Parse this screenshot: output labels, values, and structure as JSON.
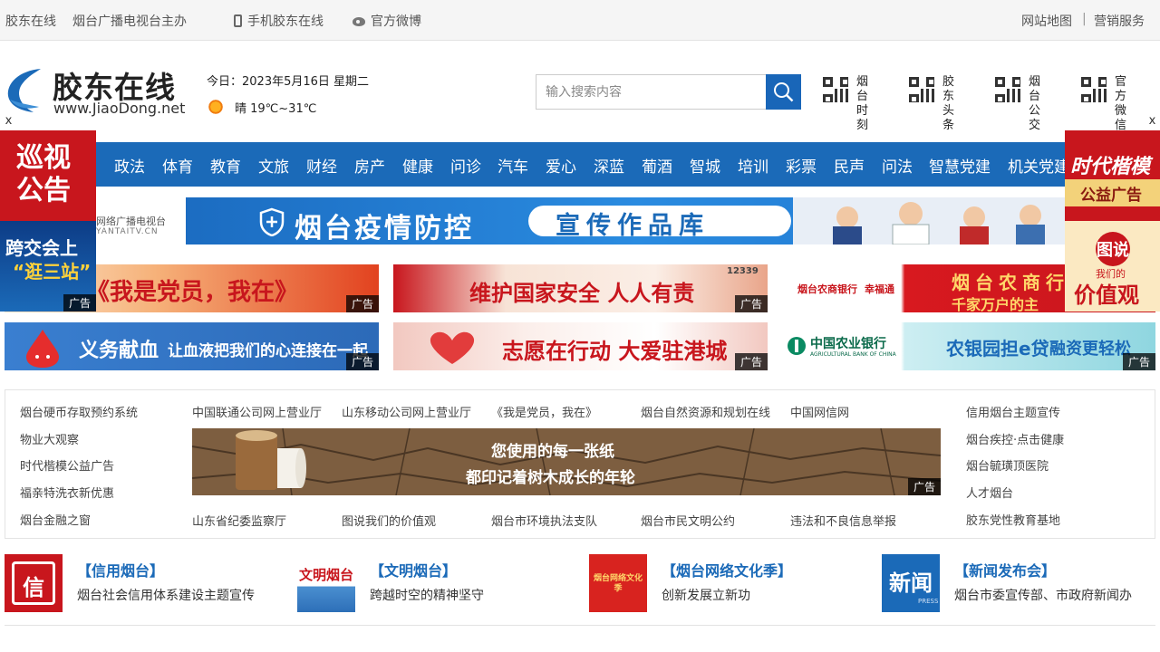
{
  "topbar": {
    "site": "胶东在线",
    "sponsor": "烟台广播电视台主办",
    "mobile": "手机胶东在线",
    "weibo": "官方微博",
    "sitemap": "网站地图",
    "sep": "|",
    "marketing": "营销服务"
  },
  "header": {
    "logo_text": "胶东在线",
    "logo_url": "www.JiaoDong.net",
    "date": "今日：2023年5月16日 星期二",
    "weather": "晴 19℃~31℃",
    "search_placeholder": "输入搜索内容",
    "qr_items": [
      {
        "label": "烟台时刻"
      },
      {
        "label": "胶东头条"
      },
      {
        "label": "烟台公交"
      },
      {
        "label": "官方微信"
      }
    ]
  },
  "nav": {
    "items": [
      "政法",
      "体育",
      "教育",
      "文旅",
      "财经",
      "房产",
      "健康",
      "问诊",
      "汽车",
      "爱心",
      "深蓝",
      "葡酒",
      "智城",
      "培训",
      "彩票",
      "民声",
      "问法",
      "智慧党建",
      "机关党建"
    ]
  },
  "side_ads": {
    "close": "x",
    "left_top": [
      "巡视",
      "公告"
    ],
    "left_bottom": [
      "跨交会上",
      "“逛三站”"
    ],
    "right_top": [
      "时代楷模",
      "公益广告"
    ],
    "right_bottom": [
      "图说",
      "我们的",
      "价值观"
    ],
    "ad_label": "广告"
  },
  "banner": {
    "logo_text": "网络广播电视台",
    "logo_url": "YANTAITV.CN",
    "title": "烟台疫情防控",
    "pill": "宣传作品库"
  },
  "ads": [
    {
      "text": "《我是党员，我在》",
      "label": "广告"
    },
    {
      "text": "维护国家安全 人人有责",
      "badge": "12339",
      "label": "广告"
    },
    {
      "bank": "烟台农商银行",
      "brand": "幸福通",
      "text": "烟台农商行",
      "sub": "千家万户的主",
      "label": "广告"
    },
    {
      "text": "义务献血",
      "sub": "让血液把我们的心连接在一起",
      "label": "广告"
    },
    {
      "text": "志愿在行动 大爱驻港城",
      "label": "广告"
    },
    {
      "bank": "中国农业银行",
      "bank_en": "AGRICULTURAL BANK OF CHINA",
      "text": "农银园担e贷",
      "sub": "融资更轻松",
      "label": "广告"
    }
  ],
  "links": {
    "left": [
      "烟台硬币存取预约系统",
      "物业大观察",
      "时代楷模公益广告",
      "福亲特洗衣新优惠",
      "烟台金融之窗"
    ],
    "top": [
      "中国联通公司网上营业厅",
      "山东移动公司网上营业厅",
      "《我是党员，我在》",
      "烟台自然资源和规划在线",
      "中国网信网"
    ],
    "right": [
      "信用烟台主题宣传",
      "烟台疾控·点击健康",
      "烟台毓璜顶医院",
      "人才烟台",
      "胶东党性教育基地"
    ],
    "bottom": [
      "山东省纪委监察厅",
      "图说我们的价值观",
      "烟台市环境执法支队",
      "烟台市民文明公约",
      "违法和不良信息举报"
    ]
  },
  "center_ad": {
    "line1": "您使用的每一张纸",
    "line2": "都印记着树木成长的年轮",
    "label": "广告"
  },
  "features": [
    {
      "title": "【信用烟台】",
      "desc": "烟台社会信用体系建设主题宣传",
      "thumb": "信"
    },
    {
      "title": "【文明烟台】",
      "desc": "跨越时空的精神坚守",
      "thumb": "文明烟台"
    },
    {
      "title": "【烟台网络文化季】",
      "desc": "创新发展立新功",
      "thumb": "烟台网络文化季"
    },
    {
      "title": "【新闻发布会】",
      "desc": "烟台市委宣传部、市政府新闻办",
      "thumb": "新闻",
      "thumb_sub": "PRESS"
    }
  ],
  "colors": {
    "nav_blue": "#1b6ab8",
    "search_blue": "#1966b8",
    "ad_red": "#c8161d"
  }
}
